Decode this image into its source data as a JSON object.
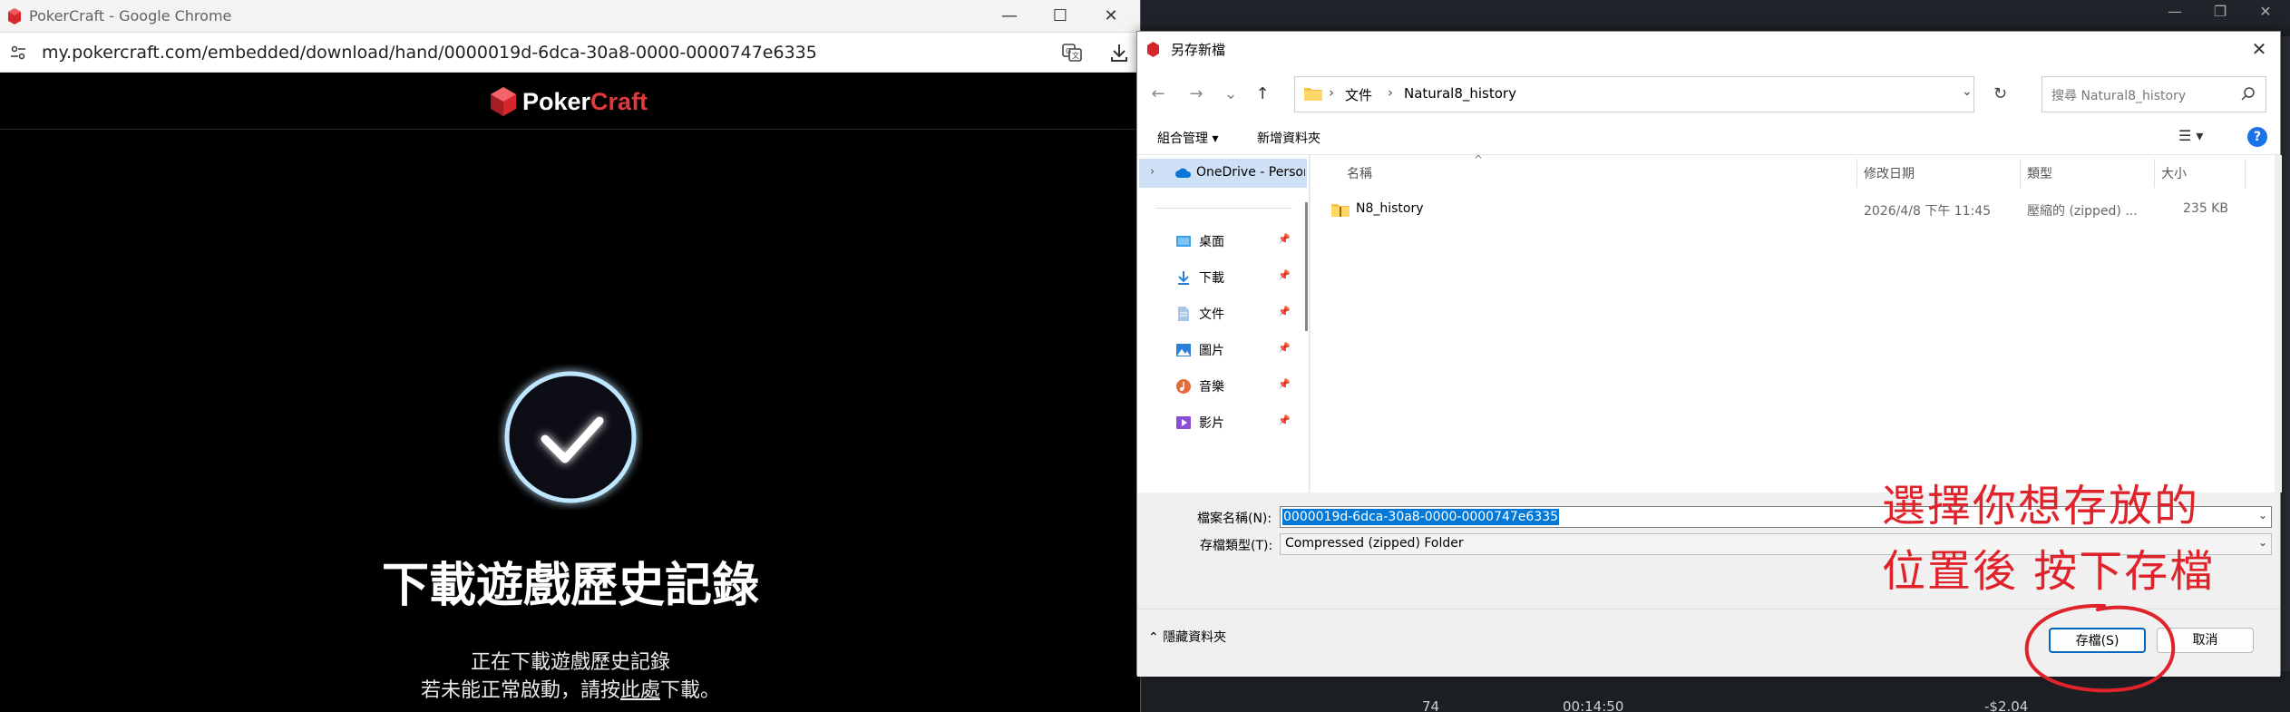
{
  "chrome": {
    "window_title": "PokerCraft - Google Chrome",
    "url": "my.pokercraft.com/embedded/download/hand/0000019d-6dca-30a8-0000-0000747e6335",
    "brand_poker": "Poker",
    "brand_craft": "Craft",
    "heading": "下載遊戲歷史記錄",
    "subtitle_line1": "正在下載遊戲歷史記錄",
    "subtitle_line2_pre": "若未能正常啟動，請按",
    "subtitle_line2_link": "此處",
    "subtitle_line2_post": "下載。",
    "min_glyph": "—",
    "max_glyph": "☐",
    "close_glyph": "✕"
  },
  "background_app": {
    "stat_1": "74",
    "stat_2": "00:14:50",
    "stat_3": "-$2.04"
  },
  "dialog": {
    "title": "另存新檔",
    "close_glyph": "✕",
    "nav": {
      "back": "←",
      "forward": "→",
      "recent": "⌄",
      "up": "↑"
    },
    "breadcrumb": [
      "文件",
      "Natural8_history"
    ],
    "breadcrumb_sep": "›",
    "search_placeholder": "搜尋 Natural8_history",
    "organize_label": "組合管理 ▾",
    "new_folder_label": "新增資料夾",
    "view_glyph": "☰ ▾",
    "help_glyph": "?",
    "nav_pane": {
      "onedrive_label": "OneDrive - Personal",
      "quick_access": [
        {
          "label": "桌面",
          "icon": "desktop-icon"
        },
        {
          "label": "下載",
          "icon": "download-icon"
        },
        {
          "label": "文件",
          "icon": "documents-icon"
        },
        {
          "label": "圖片",
          "icon": "pictures-icon"
        },
        {
          "label": "音樂",
          "icon": "music-icon"
        },
        {
          "label": "影片",
          "icon": "videos-icon"
        }
      ]
    },
    "columns": {
      "name": "名稱",
      "modified": "修改日期",
      "type": "類型",
      "size": "大小"
    },
    "files": [
      {
        "name": "N8_history",
        "modified": "2026/4/8 下午 11:45",
        "type": "壓縮的 (zipped) ...",
        "size": "235 KB"
      }
    ],
    "filename_label": "檔案名稱(N):",
    "filename_value": "0000019d-6dca-30a8-0000-0000747e6335",
    "filetype_label": "存檔類型(T):",
    "filetype_value": "Compressed (zipped) Folder",
    "hide_folders_label": "隱藏資料夾",
    "save_button": "存檔(S)",
    "cancel_button": "取消"
  },
  "annotation": {
    "line1": "選擇你想存放的",
    "line2": "位置後 按下存檔",
    "color": "#e0232b"
  }
}
